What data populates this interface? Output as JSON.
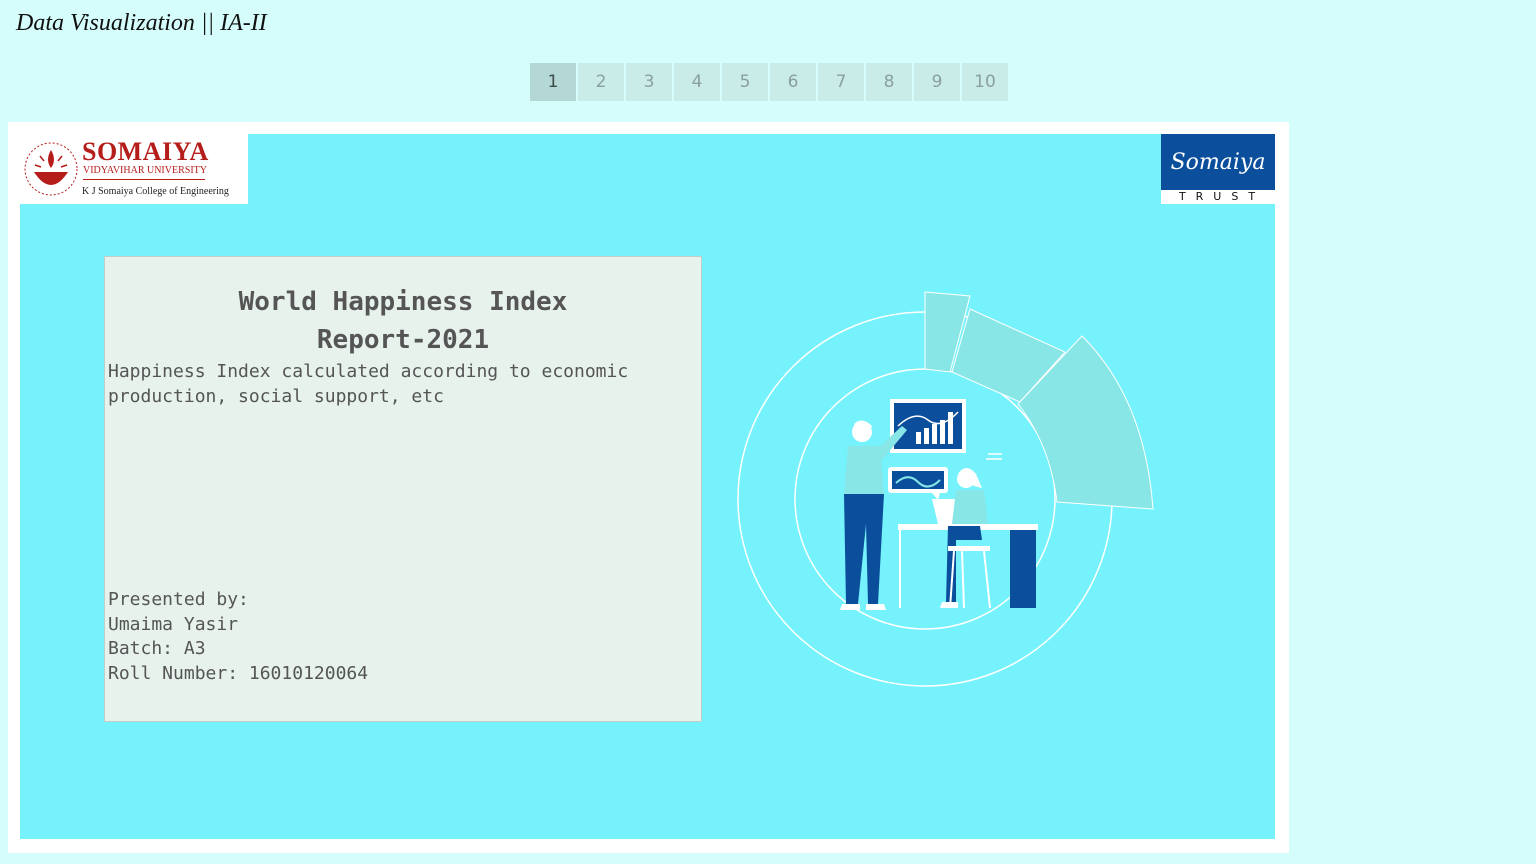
{
  "header": {
    "title": "Data Visualization || IA-II"
  },
  "pager": {
    "pages": [
      "1",
      "2",
      "3",
      "4",
      "5",
      "6",
      "7",
      "8",
      "9",
      "10"
    ],
    "active": "1"
  },
  "slide": {
    "logo_left": {
      "name": "SOMAIYA",
      "sub": "VIDYAVIHAR UNIVERSITY",
      "college": "K J Somaiya College of Engineering"
    },
    "logo_right": {
      "script": "Somaiya",
      "sub": "TRUST"
    },
    "card": {
      "title_line1": "World Happiness Index",
      "title_line2": "Report-2021",
      "subtitle": "Happiness Index calculated according to economic production, social support, etc",
      "presented_by": "Presented by:",
      "name": "Umaima Yasir",
      "batch": "Batch: A3",
      "roll": "Roll Number: 16010120064"
    }
  },
  "colors": {
    "page_bg": "#d5fdfb",
    "slide_bg": "#75f2fc",
    "card_bg": "#e6f2eb",
    "brand_red": "#b51d1b",
    "brand_blue": "#0b4e9b",
    "pager_active": "#b3d8d6",
    "pager_bg": "#c9ece9"
  }
}
